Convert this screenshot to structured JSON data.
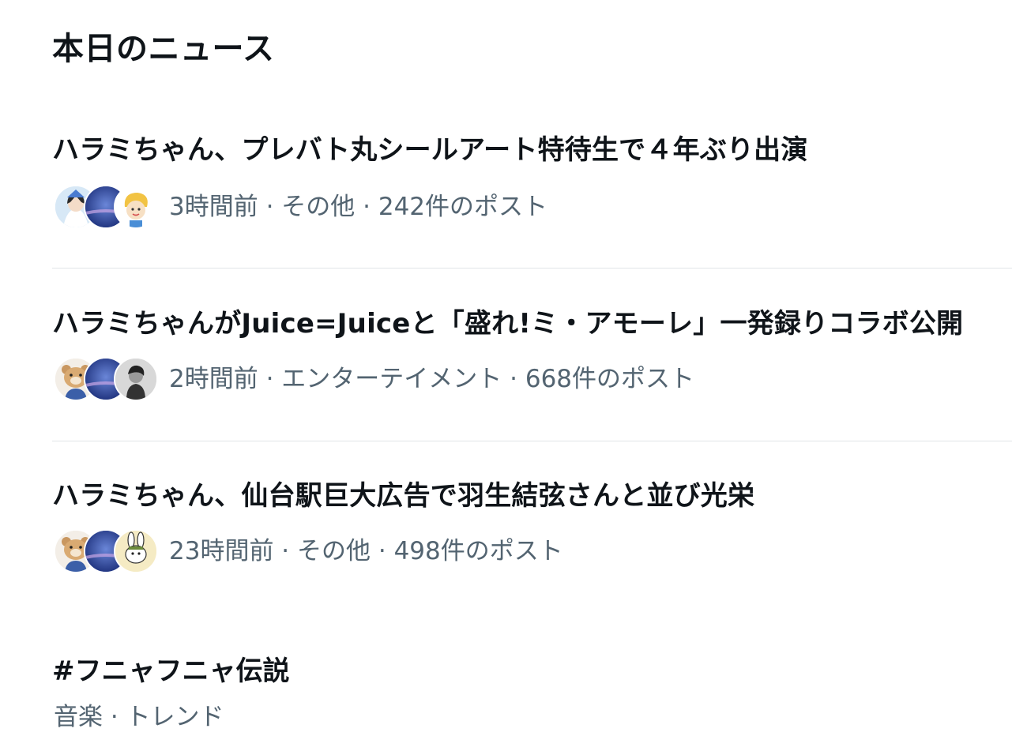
{
  "section": {
    "title": "本日のニュース"
  },
  "news": [
    {
      "headline": "ハラミちゃん、プレバト丸シールアート特待生で４年ぶり出演",
      "meta": "3時間前 · その他 · 242件のポスト",
      "avatars": [
        "anime-girl-avatar",
        "night-sky-avatar",
        "cartoon-character-avatar"
      ]
    },
    {
      "headline": "ハラミちゃんがJuice=Juiceと「盛れ!ミ・アモーレ」一発録りコラボ公開",
      "meta": "2時間前 · エンターテイメント · 668件のポスト",
      "avatars": [
        "plush-bear-avatar",
        "night-sky-avatar",
        "monochrome-portrait-avatar"
      ]
    },
    {
      "headline": "ハラミちゃん、仙台駅巨大広告で羽生結弦さんと並び光栄",
      "meta": "23時間前 · その他 · 498件のポスト",
      "avatars": [
        "plush-bear-avatar",
        "night-sky-avatar",
        "rabbit-character-avatar"
      ]
    }
  ],
  "trend": {
    "name": "#フニャフニャ伝説",
    "meta": "音楽 · トレンド"
  },
  "colors": {
    "text_primary": "#0f1419",
    "text_secondary": "#536471",
    "divider": "#e1e5e8",
    "night_sky": "#2f4fa8"
  }
}
